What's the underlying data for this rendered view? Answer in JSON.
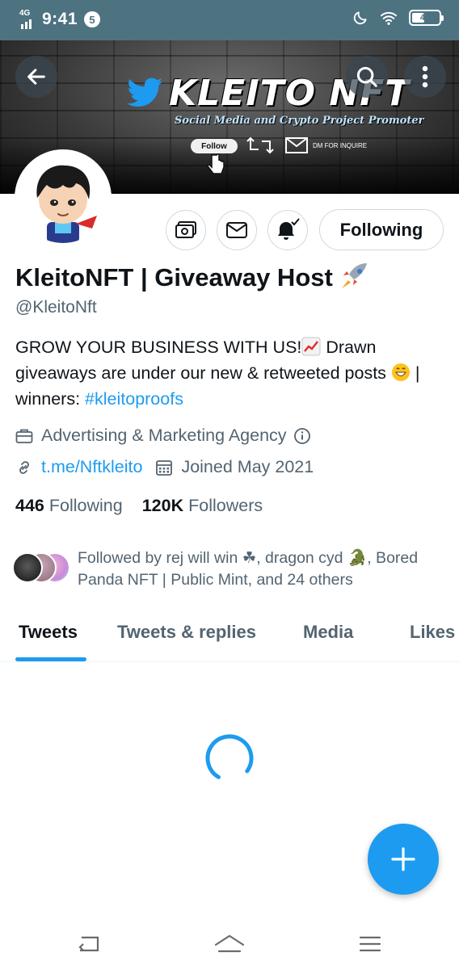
{
  "status_bar": {
    "network": "4G",
    "time": "9:41",
    "notification_count": "5",
    "battery": "48",
    "battery_level": 0.48
  },
  "banner": {
    "brand_name": "KLEITO NFT",
    "tagline": "Social Media and Crypto Project Promoter",
    "follow_label": "Follow",
    "dm_label": "DM FOR INQUIRE"
  },
  "profile": {
    "display_name": "KleitoNFT | Giveaway Host",
    "handle": "@KleitoNft",
    "bio_part1": "GROW YOUR BUSINESS WITH US!",
    "bio_part2": " Drawn giveaways are under our new & retweeted posts ",
    "bio_part3": " | winners: ",
    "bio_hashtag": "#kleitoproofs",
    "category": "Advertising & Marketing Agency",
    "link": "t.me/Nftkleito",
    "joined": "Joined May 2021"
  },
  "actions": {
    "following_label": "Following"
  },
  "stats": {
    "following_count": "446",
    "following_label": "Following",
    "followers_count": "120K",
    "followers_label": "Followers"
  },
  "followed_by": {
    "text": "Followed by rej will win ☘, dragon cyd 🐊, Bored Panda NFT | Public Mint, and 24 others"
  },
  "tabs": [
    {
      "label": "Tweets"
    },
    {
      "label": "Tweets & replies"
    },
    {
      "label": "Media"
    },
    {
      "label": "Likes"
    }
  ],
  "colors": {
    "accent": "#1d9bf0",
    "status_bar": "#4d7381",
    "secondary_text": "#536471"
  },
  "icons": {
    "back": "arrow-left-icon",
    "search": "search-icon",
    "more": "more-vertical-icon",
    "tip": "tip-jar-icon",
    "message": "envelope-icon",
    "notifications": "bell-check-icon",
    "category": "briefcase-icon",
    "link": "link-icon",
    "calendar": "calendar-icon",
    "compose": "plus-icon"
  }
}
